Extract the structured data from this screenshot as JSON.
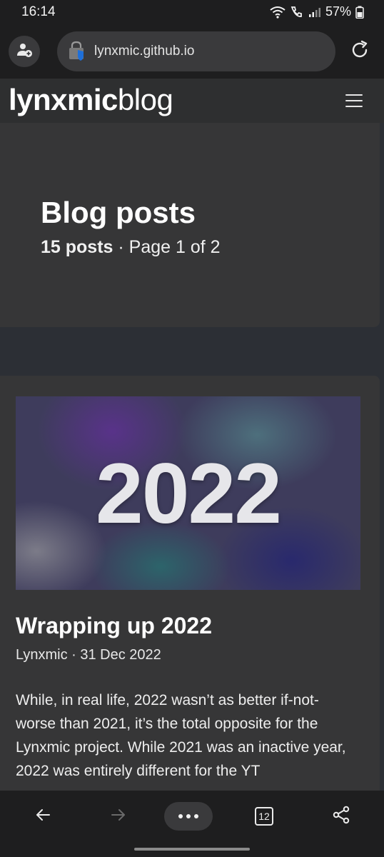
{
  "status_bar": {
    "time": "16:14",
    "battery": "57%",
    "icons": [
      "wifi-icon",
      "call-icon",
      "signal-icon",
      "battery-icon"
    ]
  },
  "browser": {
    "url": "lynxmic.github.io",
    "icons": [
      "profile-icon",
      "lock-icon",
      "reload-icon"
    ]
  },
  "site": {
    "logo_bold": "lynxmic",
    "logo_light": "blog",
    "menu_icon": "hamburger-menu-icon"
  },
  "listing": {
    "title": "Blog posts",
    "post_count": "15 posts",
    "separator": " · ",
    "page_info": "Page 1 of 2"
  },
  "post": {
    "image_text": "2022",
    "title": "Wrapping up 2022",
    "meta": "Lynxmic · 31 Dec 2022",
    "excerpt": "While, in real life, 2022 wasn’t as better if-not-worse than 2021, it’s the total opposite for the Lynxmic project. While 2021 was an inactive year, 2022 was entirely different for the YT"
  },
  "toolbar": {
    "tab_count": "12",
    "icons": [
      "back-arrow-icon",
      "forward-arrow-icon",
      "more-icon",
      "tabs-icon",
      "share-icon"
    ]
  },
  "colors": {
    "background": "#1e1e1f",
    "header": "#2e2f30",
    "card": "#363637",
    "page_band": "#2c2f35",
    "lock_accent": "#1e6fd9"
  }
}
